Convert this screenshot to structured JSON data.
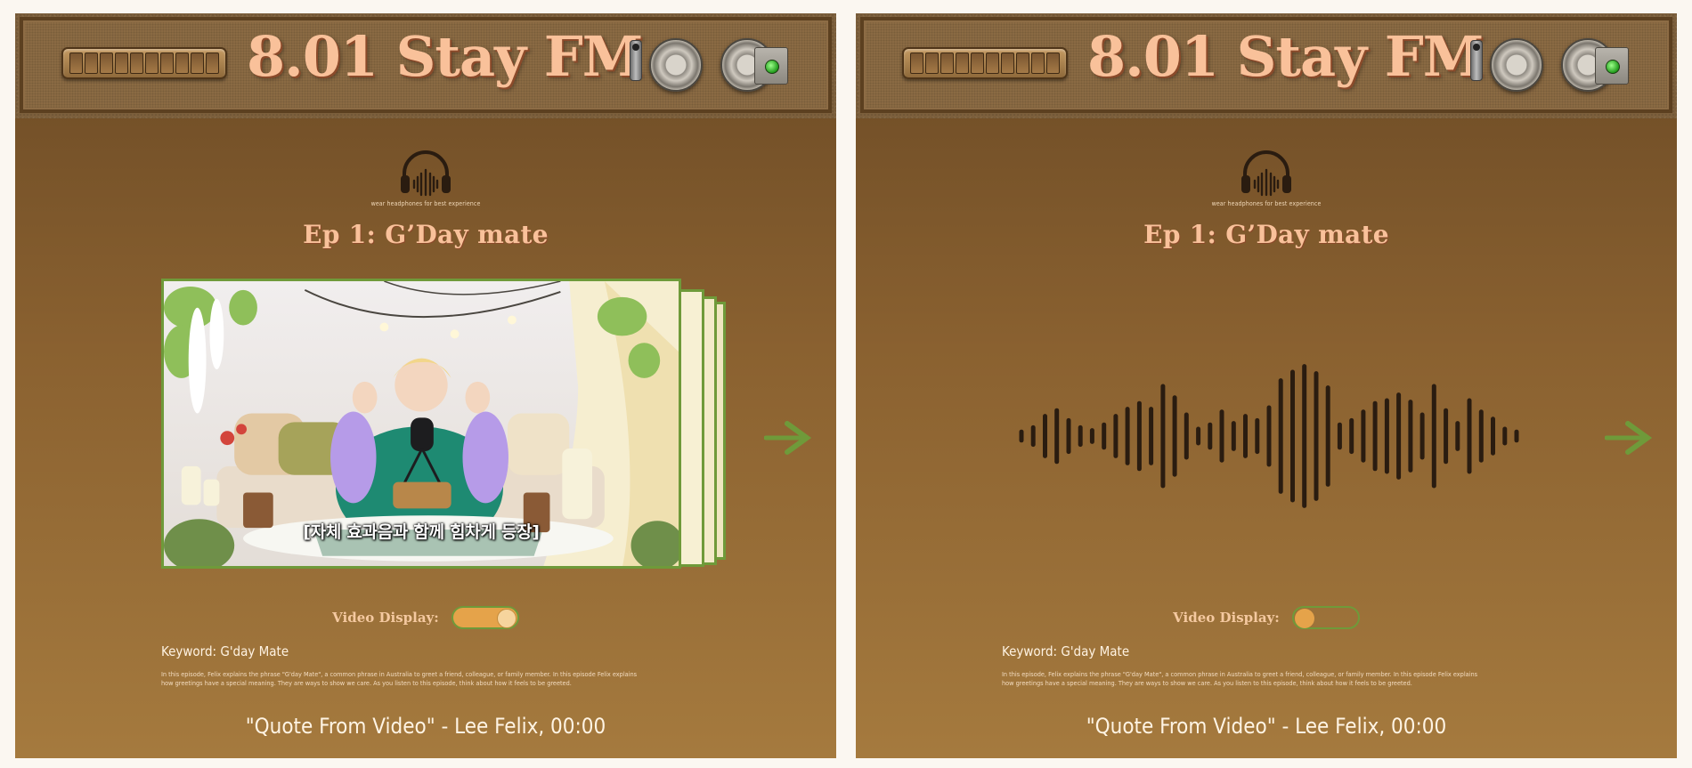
{
  "header": {
    "station_name": "8.01 Stay FM",
    "grille_slots": 10
  },
  "intro": {
    "headphones_caption": "wear headphones for best experience",
    "episode_title": "Ep 1: G’Day mate"
  },
  "panels": [
    {
      "id": "left",
      "mode": "video",
      "video": {
        "subtitle": "[자체 효과음과 함께 힘차게 등장]"
      },
      "toggle": {
        "label": "Video Display:",
        "state": "on"
      }
    },
    {
      "id": "right",
      "mode": "audio",
      "waveform_levels": [
        0.06,
        0.12,
        0.28,
        0.36,
        0.22,
        0.12,
        0.08,
        0.16,
        0.28,
        0.38,
        0.46,
        0.38,
        0.7,
        0.54,
        0.3,
        0.1,
        0.16,
        0.34,
        0.18,
        0.28,
        0.22,
        0.4,
        0.78,
        0.9,
        0.98,
        0.88,
        0.68,
        0.16,
        0.22,
        0.34,
        0.46,
        0.5,
        0.58,
        0.48,
        0.3,
        0.7,
        0.36,
        0.18,
        0.5,
        0.34,
        0.24,
        0.1,
        0.06
      ],
      "toggle": {
        "label": "Video Display:",
        "state": "off"
      }
    }
  ],
  "info": {
    "keyword": "Keyword: G'day Mate",
    "description_line1": "In this episode, Felix explains the phrase \"G'day Mate\", a common phrase in Australia to greet a friend, colleague, or family member. In this episode Felix explains",
    "description_line2": "how greetings have a special meaning. They are ways to show we care. As you listen to this episode, think about how it feels to be greeted.",
    "quote": "\"Quote From Video\" - Lee Felix, 00:00"
  },
  "colors": {
    "accent_green": "#6f9a3a",
    "title_peach": "#f9c19a",
    "toggle_orange": "#e5a34a"
  },
  "icons": [
    "headphones-icon",
    "next-arrow-icon",
    "power-led-icon"
  ]
}
